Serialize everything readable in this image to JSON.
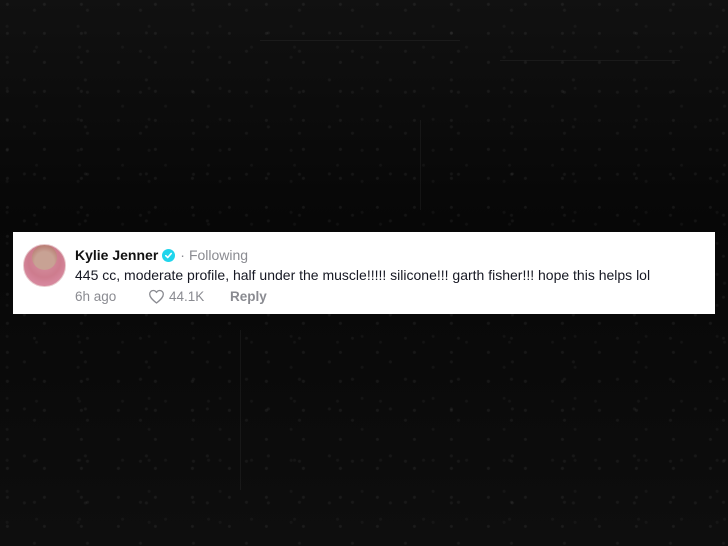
{
  "comment": {
    "username": "Kylie Jenner",
    "verified_icon": "verified-badge-icon",
    "separator": "·",
    "follow_status": "Following",
    "text": "445 cc, moderate profile, half under the muscle!!!!! silicone!!! garth fisher!!! hope this helps lol",
    "time_ago": "6h ago",
    "like_icon": "heart-icon",
    "like_count": "44.1K",
    "reply_label": "Reply"
  },
  "colors": {
    "background": "#0b0b0b",
    "card": "#ffffff",
    "verified": "#20d5ec",
    "muted_text": "#8a8b91",
    "primary_text": "#161823"
  }
}
